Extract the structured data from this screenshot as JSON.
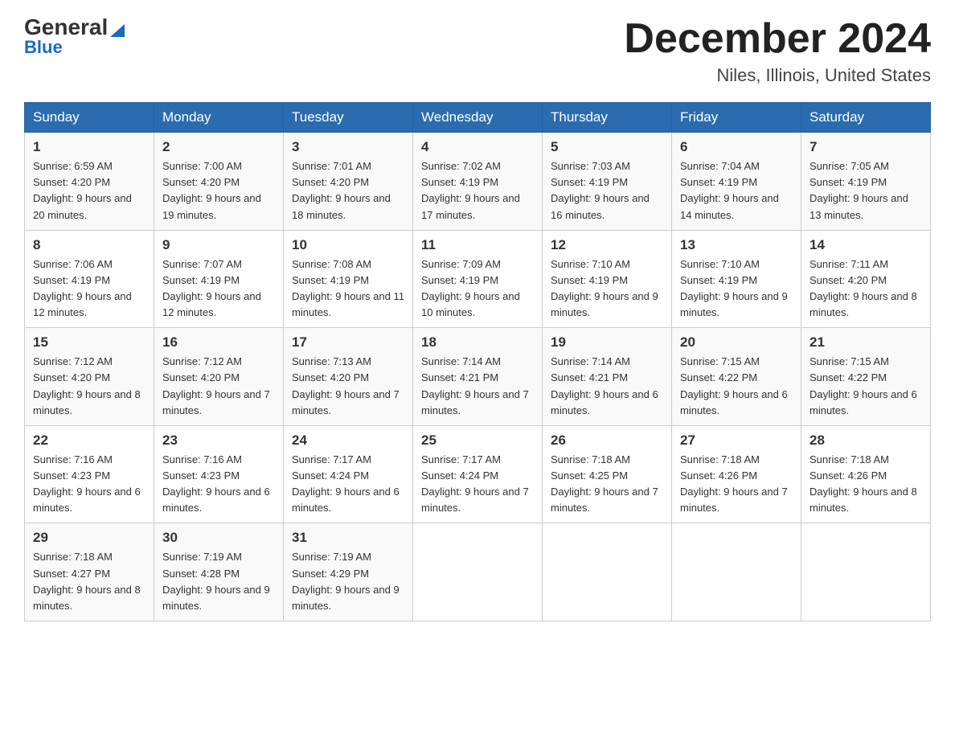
{
  "logo": {
    "text_general": "General",
    "triangle": "▶",
    "text_blue": "Blue"
  },
  "header": {
    "month_title": "December 2024",
    "location": "Niles, Illinois, United States"
  },
  "days_of_week": [
    "Sunday",
    "Monday",
    "Tuesday",
    "Wednesday",
    "Thursday",
    "Friday",
    "Saturday"
  ],
  "weeks": [
    [
      {
        "day": "1",
        "sunrise": "Sunrise: 6:59 AM",
        "sunset": "Sunset: 4:20 PM",
        "daylight": "Daylight: 9 hours and 20 minutes."
      },
      {
        "day": "2",
        "sunrise": "Sunrise: 7:00 AM",
        "sunset": "Sunset: 4:20 PM",
        "daylight": "Daylight: 9 hours and 19 minutes."
      },
      {
        "day": "3",
        "sunrise": "Sunrise: 7:01 AM",
        "sunset": "Sunset: 4:20 PM",
        "daylight": "Daylight: 9 hours and 18 minutes."
      },
      {
        "day": "4",
        "sunrise": "Sunrise: 7:02 AM",
        "sunset": "Sunset: 4:19 PM",
        "daylight": "Daylight: 9 hours and 17 minutes."
      },
      {
        "day": "5",
        "sunrise": "Sunrise: 7:03 AM",
        "sunset": "Sunset: 4:19 PM",
        "daylight": "Daylight: 9 hours and 16 minutes."
      },
      {
        "day": "6",
        "sunrise": "Sunrise: 7:04 AM",
        "sunset": "Sunset: 4:19 PM",
        "daylight": "Daylight: 9 hours and 14 minutes."
      },
      {
        "day": "7",
        "sunrise": "Sunrise: 7:05 AM",
        "sunset": "Sunset: 4:19 PM",
        "daylight": "Daylight: 9 hours and 13 minutes."
      }
    ],
    [
      {
        "day": "8",
        "sunrise": "Sunrise: 7:06 AM",
        "sunset": "Sunset: 4:19 PM",
        "daylight": "Daylight: 9 hours and 12 minutes."
      },
      {
        "day": "9",
        "sunrise": "Sunrise: 7:07 AM",
        "sunset": "Sunset: 4:19 PM",
        "daylight": "Daylight: 9 hours and 12 minutes."
      },
      {
        "day": "10",
        "sunrise": "Sunrise: 7:08 AM",
        "sunset": "Sunset: 4:19 PM",
        "daylight": "Daylight: 9 hours and 11 minutes."
      },
      {
        "day": "11",
        "sunrise": "Sunrise: 7:09 AM",
        "sunset": "Sunset: 4:19 PM",
        "daylight": "Daylight: 9 hours and 10 minutes."
      },
      {
        "day": "12",
        "sunrise": "Sunrise: 7:10 AM",
        "sunset": "Sunset: 4:19 PM",
        "daylight": "Daylight: 9 hours and 9 minutes."
      },
      {
        "day": "13",
        "sunrise": "Sunrise: 7:10 AM",
        "sunset": "Sunset: 4:19 PM",
        "daylight": "Daylight: 9 hours and 9 minutes."
      },
      {
        "day": "14",
        "sunrise": "Sunrise: 7:11 AM",
        "sunset": "Sunset: 4:20 PM",
        "daylight": "Daylight: 9 hours and 8 minutes."
      }
    ],
    [
      {
        "day": "15",
        "sunrise": "Sunrise: 7:12 AM",
        "sunset": "Sunset: 4:20 PM",
        "daylight": "Daylight: 9 hours and 8 minutes."
      },
      {
        "day": "16",
        "sunrise": "Sunrise: 7:12 AM",
        "sunset": "Sunset: 4:20 PM",
        "daylight": "Daylight: 9 hours and 7 minutes."
      },
      {
        "day": "17",
        "sunrise": "Sunrise: 7:13 AM",
        "sunset": "Sunset: 4:20 PM",
        "daylight": "Daylight: 9 hours and 7 minutes."
      },
      {
        "day": "18",
        "sunrise": "Sunrise: 7:14 AM",
        "sunset": "Sunset: 4:21 PM",
        "daylight": "Daylight: 9 hours and 7 minutes."
      },
      {
        "day": "19",
        "sunrise": "Sunrise: 7:14 AM",
        "sunset": "Sunset: 4:21 PM",
        "daylight": "Daylight: 9 hours and 6 minutes."
      },
      {
        "day": "20",
        "sunrise": "Sunrise: 7:15 AM",
        "sunset": "Sunset: 4:22 PM",
        "daylight": "Daylight: 9 hours and 6 minutes."
      },
      {
        "day": "21",
        "sunrise": "Sunrise: 7:15 AM",
        "sunset": "Sunset: 4:22 PM",
        "daylight": "Daylight: 9 hours and 6 minutes."
      }
    ],
    [
      {
        "day": "22",
        "sunrise": "Sunrise: 7:16 AM",
        "sunset": "Sunset: 4:23 PM",
        "daylight": "Daylight: 9 hours and 6 minutes."
      },
      {
        "day": "23",
        "sunrise": "Sunrise: 7:16 AM",
        "sunset": "Sunset: 4:23 PM",
        "daylight": "Daylight: 9 hours and 6 minutes."
      },
      {
        "day": "24",
        "sunrise": "Sunrise: 7:17 AM",
        "sunset": "Sunset: 4:24 PM",
        "daylight": "Daylight: 9 hours and 6 minutes."
      },
      {
        "day": "25",
        "sunrise": "Sunrise: 7:17 AM",
        "sunset": "Sunset: 4:24 PM",
        "daylight": "Daylight: 9 hours and 7 minutes."
      },
      {
        "day": "26",
        "sunrise": "Sunrise: 7:18 AM",
        "sunset": "Sunset: 4:25 PM",
        "daylight": "Daylight: 9 hours and 7 minutes."
      },
      {
        "day": "27",
        "sunrise": "Sunrise: 7:18 AM",
        "sunset": "Sunset: 4:26 PM",
        "daylight": "Daylight: 9 hours and 7 minutes."
      },
      {
        "day": "28",
        "sunrise": "Sunrise: 7:18 AM",
        "sunset": "Sunset: 4:26 PM",
        "daylight": "Daylight: 9 hours and 8 minutes."
      }
    ],
    [
      {
        "day": "29",
        "sunrise": "Sunrise: 7:18 AM",
        "sunset": "Sunset: 4:27 PM",
        "daylight": "Daylight: 9 hours and 8 minutes."
      },
      {
        "day": "30",
        "sunrise": "Sunrise: 7:19 AM",
        "sunset": "Sunset: 4:28 PM",
        "daylight": "Daylight: 9 hours and 9 minutes."
      },
      {
        "day": "31",
        "sunrise": "Sunrise: 7:19 AM",
        "sunset": "Sunset: 4:29 PM",
        "daylight": "Daylight: 9 hours and 9 minutes."
      },
      null,
      null,
      null,
      null
    ]
  ]
}
